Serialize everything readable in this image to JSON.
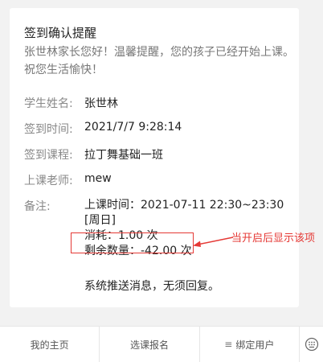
{
  "card": {
    "title": "签到确认提醒",
    "intro": "张世林家长您好！温馨提醒，您的孩子已经开始上课。祝您生活愉快！"
  },
  "fields": {
    "student": {
      "label": "学生姓名:",
      "value": "张世林"
    },
    "checkin_time": {
      "label": "签到时间:",
      "value": "2021/7/7 9:28:14"
    },
    "course": {
      "label": "签到课程:",
      "value": "拉丁舞基础一班"
    },
    "teacher": {
      "label": "上课老师:",
      "value": "mew"
    },
    "remark": {
      "label": "备注:",
      "class_time": "上课时间：2021-07-11 22:30~23:30 [周日]",
      "consumed": "消耗：1.00 次",
      "remaining": "剩余数量：-42.00 次",
      "push_notice": "系统推送消息，无须回复。"
    }
  },
  "annotation": {
    "text": "当开启后显示该项",
    "color": "#e53935"
  },
  "bottom_nav": {
    "items": [
      {
        "label": "我的主页"
      },
      {
        "label": "选课报名"
      },
      {
        "label": "绑定用户",
        "icon": "menu-icon"
      }
    ],
    "side_icon": "keyboard-icon"
  }
}
